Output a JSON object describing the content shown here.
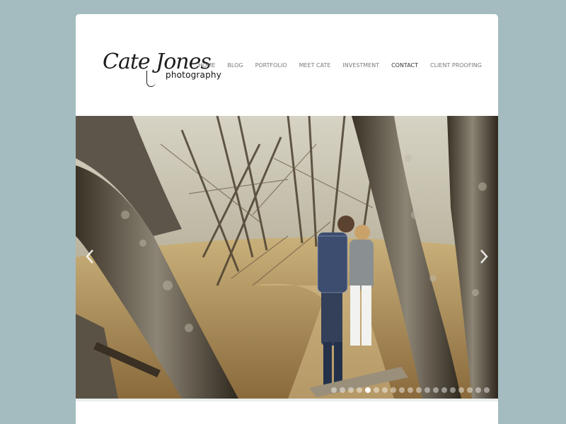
{
  "brand": {
    "logo_script": "Cate Jones",
    "logo_sub": "photography"
  },
  "nav": {
    "items": [
      "HOME",
      "BLOG",
      "PORTFOLIO",
      "MEET CATE",
      "INVESTMENT",
      "CONTACT",
      "CLIENT PROOFING"
    ],
    "active_item": "CONTACT"
  },
  "slider": {
    "image": "couple-kissing-in-forest",
    "prev_icon": "chevron-left-icon",
    "next_icon": "chevron-right-icon",
    "slide_count": 19,
    "current_slide": 4
  },
  "tagline": {
    "text": "..."
  },
  "colors": {
    "page_background": "#a4bcbf",
    "card_background": "#ffffff",
    "nav_text": "#7a7a7a"
  }
}
